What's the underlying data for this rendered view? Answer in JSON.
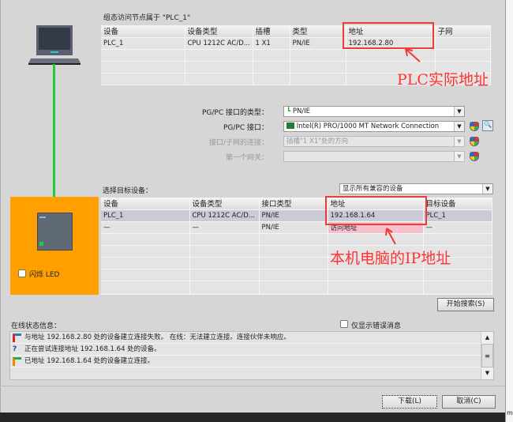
{
  "node_section": {
    "title": "组态访问节点属于 \"PLC_1\"",
    "columns": [
      "设备",
      "设备类型",
      "插槽",
      "类型",
      "地址",
      "子网"
    ],
    "rows": [
      [
        "PLC_1",
        "CPU 1212C AC/D...",
        "1 X1",
        "PN/IE",
        "192.168.2.80",
        ""
      ]
    ]
  },
  "annotations": {
    "plc_address": "PLC实际地址",
    "pc_address": "本机电脑的IP地址",
    "color": "#ff3333"
  },
  "interface": {
    "type_label": "PG/PC 接口的类型：",
    "type_value": "PN/IE",
    "if_label": "PG/PC 接口：",
    "if_value": "Intel(R) PRO/1000 MT Network Connection",
    "conn_label": "接口/子网的连接：",
    "conn_value": "插槽\"1 X1\"处的方向",
    "gateway_label": "第一个网关：",
    "gateway_value": ""
  },
  "target": {
    "label": "选择目标设备：",
    "filter": "显示所有兼容的设备",
    "columns": [
      "设备",
      "设备类型",
      "接口类型",
      "地址",
      "目标设备"
    ],
    "rows": [
      [
        "PLC_1",
        "CPU 1212C AC/D...",
        "PN/IE",
        "192.168.1.64",
        "PLC_1"
      ],
      [
        "—",
        "—",
        "PN/IE",
        "访问地址",
        "—"
      ]
    ]
  },
  "left_panel": {
    "flash_led": "闪烁 LED",
    "panel_color": "#ffa000",
    "link_color": "#22cc33"
  },
  "search_button": "开始搜索(S)",
  "status": {
    "label": "在线状态信息：",
    "errors_only": "仅显示错误消息",
    "messages": [
      {
        "icon": "connection-failed-icon",
        "text": "与地址 192.168.2.80 处的设备建立连接失败。 在线：无法建立连接。连接伙伴未响应。"
      },
      {
        "icon": "connecting-question-icon",
        "text": "正在尝试连接地址 192.168.1.64 处的设备。"
      },
      {
        "icon": "connection-ok-icon",
        "text": "已地址 192.168.1.64 处的设备建立连接。"
      }
    ]
  },
  "buttons": {
    "download": "下载(L)",
    "cancel": "取消(C)"
  },
  "edge_text": "m"
}
